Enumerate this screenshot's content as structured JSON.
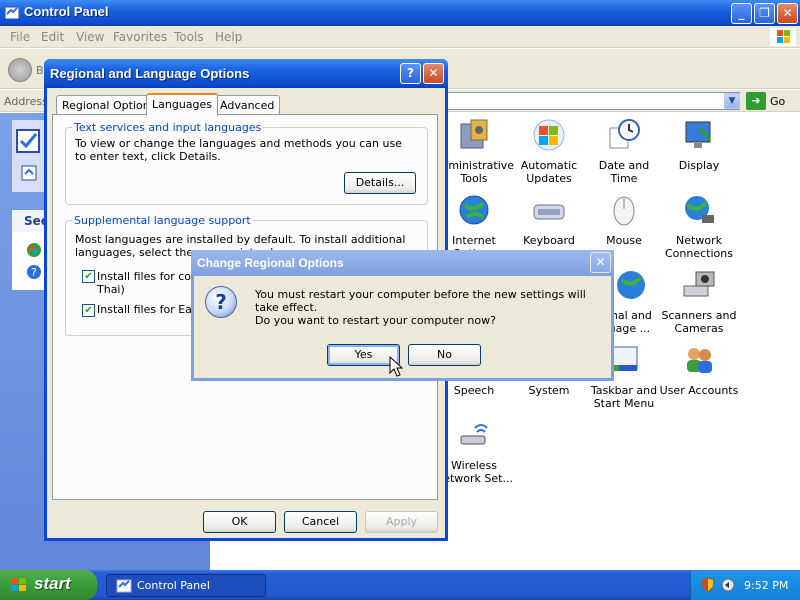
{
  "control_panel": {
    "title": "Control Panel",
    "menu": [
      "File",
      "Edit",
      "View",
      "Favorites",
      "Tools",
      "Help"
    ],
    "toolbar_back_partial": "B",
    "address_label": "Address",
    "go_label": "Go",
    "sidebar_see_label": "See",
    "items": [
      {
        "label": "Administrative Tools",
        "icon": "admin-tools-icon"
      },
      {
        "label": "Automatic Updates",
        "icon": "windows-flag-icon"
      },
      {
        "label": "Date and Time",
        "icon": "clock-icon"
      },
      {
        "label": "Display",
        "icon": "display-icon"
      },
      {
        "label": "Internet Options",
        "icon": "globe-icon"
      },
      {
        "label": "Keyboard",
        "icon": "keyboard-icon"
      },
      {
        "label": "Mouse",
        "icon": "mouse-icon"
      },
      {
        "label": "Network Connections",
        "icon": "network-icon"
      },
      {
        "label": "Regional and Language ...",
        "icon": "globe-icon"
      },
      {
        "label": "Scanners and Cameras",
        "icon": "scanner-icon"
      },
      {
        "label": "Speech",
        "icon": "speech-icon"
      },
      {
        "label": "System",
        "icon": "system-icon"
      },
      {
        "label": "Taskbar and Start Menu",
        "icon": "taskbar-icon"
      },
      {
        "label": "User Accounts",
        "icon": "users-icon"
      },
      {
        "label": "Wireless Network Set...",
        "icon": "wireless-icon"
      }
    ]
  },
  "regional_dialog": {
    "title": "Regional and Language Options",
    "tabs": [
      "Regional Options",
      "Languages",
      "Advanced"
    ],
    "active_tab": "Languages",
    "group1": {
      "title": "Text services and input languages",
      "text": "To view or change the languages and methods you can use to enter text, click Details.",
      "details_button": "Details..."
    },
    "group2": {
      "title": "Supplemental language support",
      "text": "Most languages are installed by default. To install additional languages, select the appropriate ch",
      "checkbox1_label_line1": "Install files for compl",
      "checkbox1_label_line2": "Thai)",
      "checkbox1_checked": true,
      "checkbox2_label": "Install files for East A",
      "checkbox2_checked": true
    },
    "ok_button": "OK",
    "cancel_button": "Cancel",
    "apply_button": "Apply"
  },
  "change_dialog": {
    "title": "Change Regional Options",
    "message1": "You must restart your computer before the new settings will take effect.",
    "message2": "Do you want to restart your computer now?",
    "yes_button": "Yes",
    "no_button": "No"
  },
  "taskbar": {
    "start_label": "start",
    "task_button_label": "Control Panel",
    "clock": "9:52 PM"
  }
}
